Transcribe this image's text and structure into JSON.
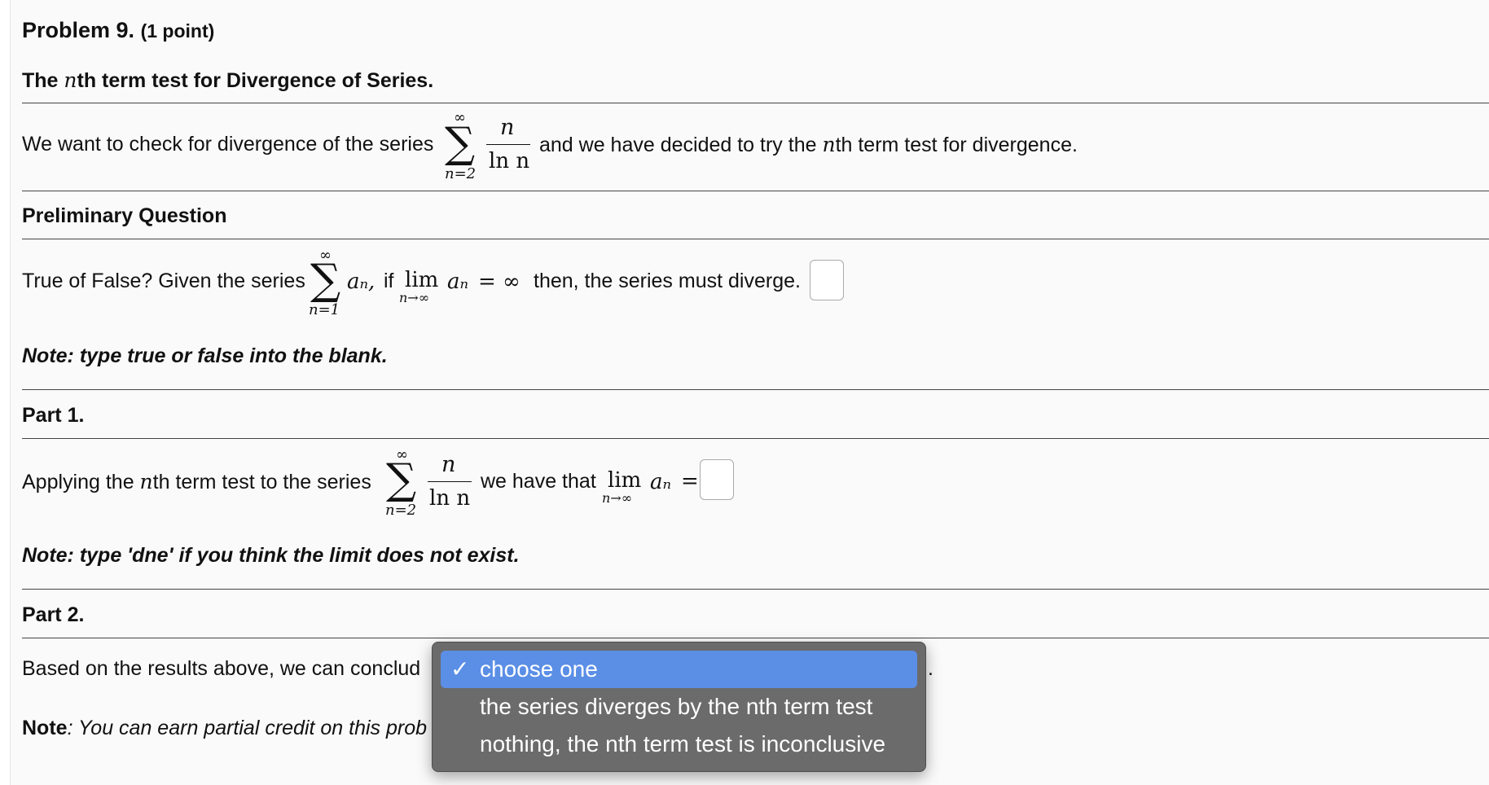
{
  "problem": {
    "title": "Problem 9.",
    "points": "(1 point)"
  },
  "intro": {
    "heading_pre": "The ",
    "heading_var": "n",
    "heading_post": "th term test for Divergence of Series.",
    "statement_pre": "We want to check for divergence of the series",
    "statement_post_a": "and we have decided to try the ",
    "statement_post_var": "n",
    "statement_post_b": "th term test for divergence.",
    "series": {
      "upper": "∞",
      "lower": "n=2",
      "numerator": "n",
      "denominator": "ln n",
      "sigma": "∑"
    }
  },
  "preliminary": {
    "heading": "Preliminary Question",
    "question_pre": "True of False? Given the series",
    "series_upper": "∞",
    "series_lower": "n=1",
    "sigma": "∑",
    "term": "aₙ,",
    "if_text": "if",
    "lim": "lim",
    "lim_sub": "n→∞",
    "lim_term": "aₙ",
    "equals_inf": "= ∞",
    "question_post": "then, the series must diverge.",
    "answer_value": "",
    "note": "Note: type true or false into the blank."
  },
  "part1": {
    "heading": "Part 1.",
    "text_pre_a": "Applying the ",
    "text_pre_var": "n",
    "text_pre_b": "th term test to the series",
    "series": {
      "upper": "∞",
      "lower": "n=2",
      "numerator": "n",
      "denominator": "ln n",
      "sigma": "∑"
    },
    "text_mid": "we have that",
    "lim": "lim",
    "lim_sub": "n→∞",
    "lim_term": "aₙ",
    "equals": "=",
    "answer_value": "",
    "note": "Note: type 'dne' if you think the limit does not exist."
  },
  "part2": {
    "heading": "Part 2.",
    "text_pre": "Based on the results above, we can conclud",
    "period": ".",
    "note_label": "Note",
    "note_text": ": You can earn partial credit on this prob",
    "dropdown": {
      "check": "✓",
      "options": [
        "choose one",
        "the series diverges by the nth term test",
        "nothing, the nth term test is inconclusive"
      ],
      "selected_index": 0
    }
  }
}
